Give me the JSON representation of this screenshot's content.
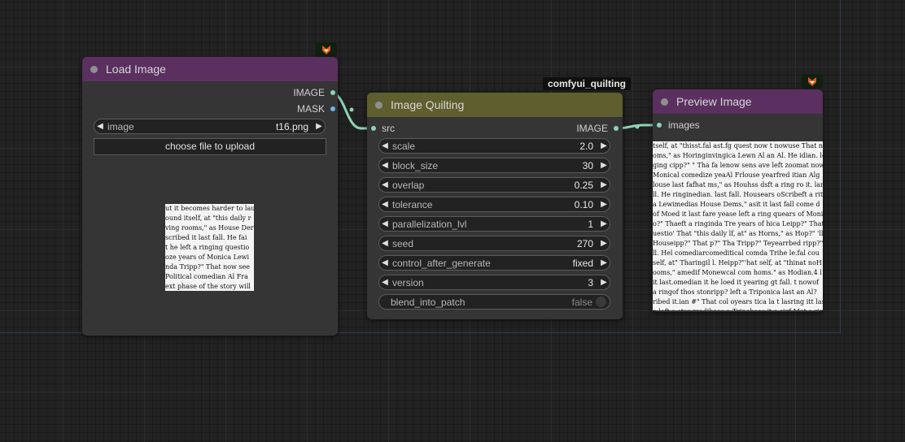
{
  "colors": {
    "canvas_bg": "#222222",
    "node_bg": "#353535",
    "title_purple": "#5b2f60",
    "title_olive": "#5e5e2e",
    "link_color": "#8ed4b4",
    "mask_color": "#64b5f6"
  },
  "load_image": {
    "title": "Load Image",
    "outputs": [
      "IMAGE",
      "MASK"
    ],
    "image_widget": {
      "name": "image",
      "value": "t16.png"
    },
    "upload_button": "choose file to upload",
    "badge_icon": "fox-icon",
    "preview_lines": [
      "ut it becomes harder to lau",
      "ound itself, at \"this daily r",
      "ving rooms,\" as House Der",
      "scribed it last fall. He fai",
      "t he left a ringing questio",
      "oze years of Monica Lewi",
      "nda Tripp?\" That now see",
      "Political comedian Al Fra",
      "ext phase of the story will"
    ]
  },
  "quilting": {
    "badge_label": "comfyui_quilting",
    "title": "Image Quilting",
    "input": "src",
    "output": "IMAGE",
    "widgets": [
      {
        "name": "scale",
        "value": "2.0"
      },
      {
        "name": "block_size",
        "value": "30"
      },
      {
        "name": "overlap",
        "value": "0.25"
      },
      {
        "name": "tolerance",
        "value": "0.10"
      },
      {
        "name": "parallelization_lvl",
        "value": "1"
      },
      {
        "name": "seed",
        "value": "270"
      },
      {
        "name": "control_after_generate",
        "value": "fixed"
      },
      {
        "name": "version",
        "value": "3"
      }
    ],
    "toggle": {
      "name": "blend_into_patch",
      "value": "false"
    }
  },
  "preview": {
    "title": "Preview Image",
    "input": "images",
    "badge_icon": "fox-icon",
    "preview_lines": [
      "tself, at \"thisst.fal ast.fg quest now t nowuse That nbe",
      "oms,\" as Horinginvingica Lewn Al an Al. He idian. le",
      "ging cipp?\" \" Tha fa lenow sens ave left zoomat now",
      "Monical comedize yeaAl Frlouse yearfred itian Alg",
      "louse last fafhat ms,\" as Houhss dsft a ring ro it. larr",
      "ll. He ringinedian. last fall. Housears oScribeft a ritu",
      "a Lewimedias House Dems,\" asit it last fall come d",
      "of Moed it last fare yease left a ring quears of Monica",
      "o?\" Thaeft a ringinda Tre years of hica Leipp?\" That nov",
      "uestio' That \"this daily lf, at\" as Horns,\" as Hop?\" 'll",
      "Houseipp?\" That p?\" Tha Tripp?\" Teyearrbed ripp?\"l",
      "ll. Hel comediarcomeditical comda Trihe le.fal cou",
      "self, at\" Tharingil l. Heipp?\"'hat self, at \"thinat noH",
      "ooms,\" amedif Monewcal com homs.\" as Hodian.4 l",
      "it last.omedian it he loed it yearing gt fall. t nowof",
      "a ringof thos stonripp? left a Triponica last an Al?",
      "ribed it.ian #\" That col oyears tica la t lasring itt last",
      "e left a stongredibase a Tripehase 't e sixf Mot a ring"
    ]
  }
}
